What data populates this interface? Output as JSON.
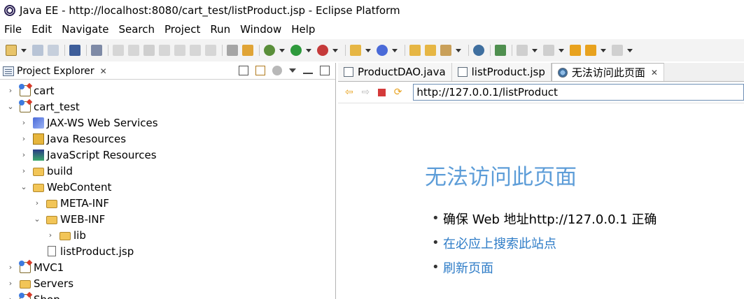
{
  "window": {
    "title": "Java EE - http://localhost:8080/cart_test/listProduct.jsp - Eclipse Platform"
  },
  "menu": [
    "File",
    "Edit",
    "Navigate",
    "Search",
    "Project",
    "Run",
    "Window",
    "Help"
  ],
  "explorer": {
    "title": "Project Explorer",
    "tree": [
      {
        "label": "cart",
        "icon": "project-icon",
        "level": 0,
        "chevron": "›"
      },
      {
        "label": "cart_test",
        "icon": "project-icon",
        "level": 0,
        "chevron": "⌄"
      },
      {
        "label": "JAX-WS Web Services",
        "icon": "web-services-icon",
        "level": 1,
        "chevron": "›"
      },
      {
        "label": "Java Resources",
        "icon": "java-resources-icon",
        "level": 1,
        "chevron": "›"
      },
      {
        "label": "JavaScript Resources",
        "icon": "javascript-resources-icon",
        "level": 1,
        "chevron": "›"
      },
      {
        "label": "build",
        "icon": "folder-icon",
        "level": 1,
        "chevron": "›"
      },
      {
        "label": "WebContent",
        "icon": "folder-icon",
        "level": 1,
        "chevron": "⌄"
      },
      {
        "label": "META-INF",
        "icon": "folder-icon",
        "level": 2,
        "chevron": "›"
      },
      {
        "label": "WEB-INF",
        "icon": "folder-icon",
        "level": 2,
        "chevron": "⌄"
      },
      {
        "label": "lib",
        "icon": "folder-icon",
        "level": 3,
        "chevron": "›"
      },
      {
        "label": "listProduct.jsp",
        "icon": "jsp-file-icon",
        "level": 2,
        "chevron": ""
      },
      {
        "label": "MVC1",
        "icon": "project-icon",
        "level": 0,
        "chevron": "›"
      },
      {
        "label": "Servers",
        "icon": "folder-icon",
        "level": 0,
        "chevron": "›"
      },
      {
        "label": "Shop",
        "icon": "project-icon",
        "level": 0,
        "chevron": "›"
      }
    ]
  },
  "editor": {
    "tabs": [
      {
        "label": "ProductDAO.java",
        "icon": "java-file-icon",
        "active": false
      },
      {
        "label": "listProduct.jsp",
        "icon": "jsp-file-icon",
        "active": false
      },
      {
        "label": "无法访问此页面",
        "icon": "web-browser-icon",
        "active": true
      }
    ],
    "browser": {
      "url": "http://127.0.0.1/listProduct",
      "error_title": "无法访问此页面",
      "items": [
        "确保 Web 地址http://127.0.0.1 正确",
        "在必应上搜索此站点",
        "刷新页面"
      ]
    }
  },
  "colors": {
    "error_title": "#5d9dd8",
    "link": "#2e7cc7",
    "toolbar_bg": "#f3f3f3"
  }
}
